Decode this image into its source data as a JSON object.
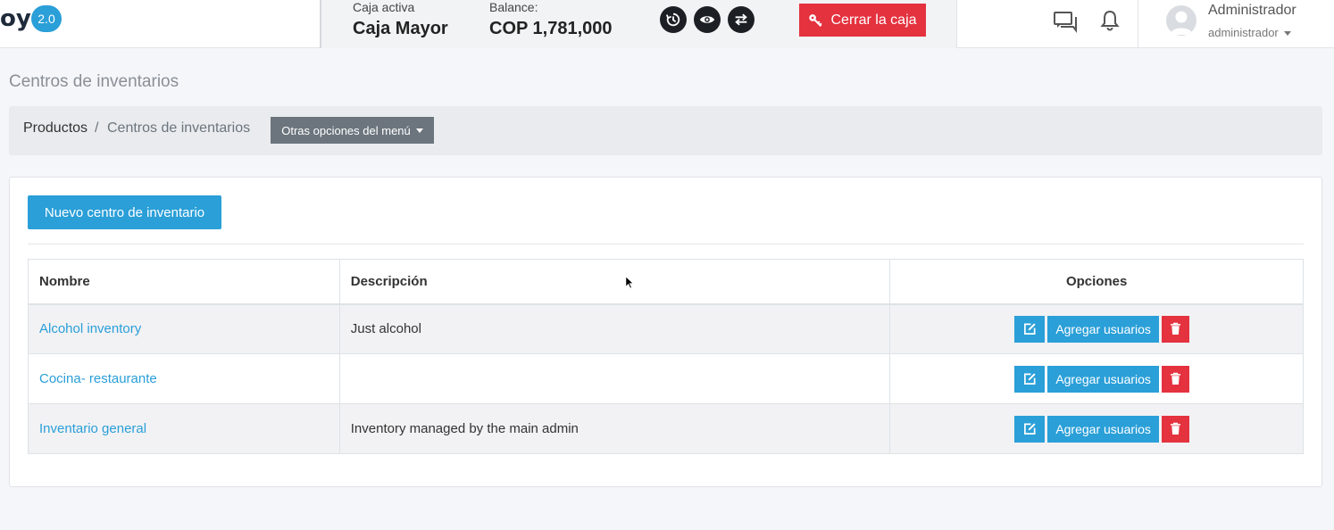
{
  "app": {
    "logo_glyph": "oy",
    "version": "2.0"
  },
  "register": {
    "active_label": "Caja activa",
    "active_value": "Caja Mayor",
    "balance_label": "Balance:",
    "balance_value": "COP 1,781,000",
    "icons": [
      "history-icon",
      "eye-icon",
      "transfer-icon"
    ],
    "close_button": "Cerrar la caja",
    "close_button_color": "#e4323f"
  },
  "header_icons": [
    "chat-icon",
    "bell-icon"
  ],
  "user": {
    "name": "Administrador",
    "role": "administrador"
  },
  "page": {
    "title": "Centros de inventarios"
  },
  "breadcrumb": {
    "items": [
      "Productos",
      "Centros de inventarios"
    ],
    "separator": "/",
    "menu_button": "Otras opciones del menú"
  },
  "actions": {
    "new_button": "Nuevo centro de inventario"
  },
  "table": {
    "headers": [
      "Nombre",
      "Descripción",
      "Opciones"
    ],
    "rows": [
      {
        "name": "Alcohol inventory",
        "description": "Just alcohol"
      },
      {
        "name": "Cocina- restaurante",
        "description": ""
      },
      {
        "name": "Inventario general",
        "description": "Inventory managed by the main admin"
      }
    ],
    "row_button": "Agregar usuarios"
  },
  "colors": {
    "primary": "#2a9fd8",
    "danger": "#e4323f",
    "secondary": "#6c757d"
  }
}
